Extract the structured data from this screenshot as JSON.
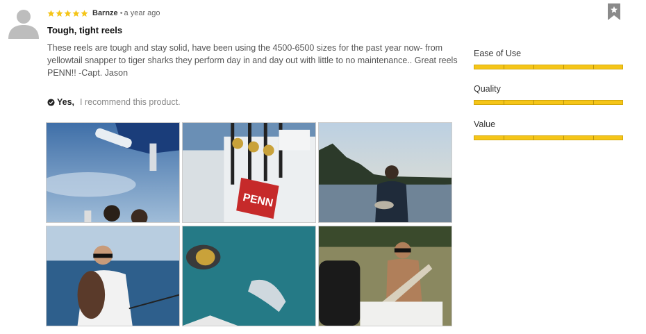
{
  "review": {
    "author": "Barnze",
    "separator": "•",
    "time_ago": "a year ago",
    "star_rating": 5,
    "headline": "Tough, tight reels",
    "body": "These reels are tough and stay solid, have been using the 4500-6500 sizes for the past year now- from yellowtail snapper to tiger sharks they perform day in and day out with little to no maintenance.. Great reels PENN!! -Capt. Jason",
    "recommend_yes": "Yes,",
    "recommend_text": "I recommend this product."
  },
  "photo_brand_text": "PENN",
  "ratings": [
    {
      "label": "Ease of Use",
      "value": 5,
      "max": 5
    },
    {
      "label": "Quality",
      "value": 5,
      "max": 5
    },
    {
      "label": "Value",
      "value": 5,
      "max": 5
    }
  ],
  "colors": {
    "star": "#f5c518",
    "bar_fill": "#f5c518",
    "bar_border": "#d4a90c"
  },
  "icons": [
    "avatar-icon",
    "star-icon",
    "check-circle-icon",
    "bookmark-star-icon"
  ]
}
